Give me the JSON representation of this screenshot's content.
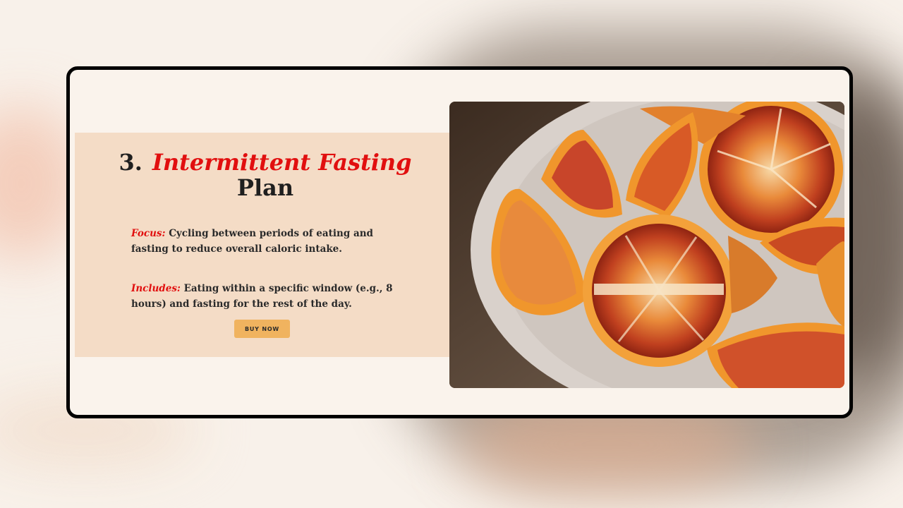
{
  "plan": {
    "number": "3.",
    "title_accent": "Intermittent Fasting",
    "title_rest": "Plan",
    "focus_label": "Focus:",
    "focus_text": "Cycling between periods of eating and fasting to reduce overall caloric intake.",
    "includes_label": "Includes:",
    "includes_text": "Eating within a specific window (e.g., 8 hours) and fasting for the rest of the day.",
    "button_label": "BUY NOW"
  },
  "colors": {
    "accent": "#e10f0f",
    "panel": "#f4dcc6",
    "button": "#f0b35f",
    "card_bg": "#faf3ec"
  },
  "image": {
    "subject": "sliced blood oranges on a plate"
  }
}
